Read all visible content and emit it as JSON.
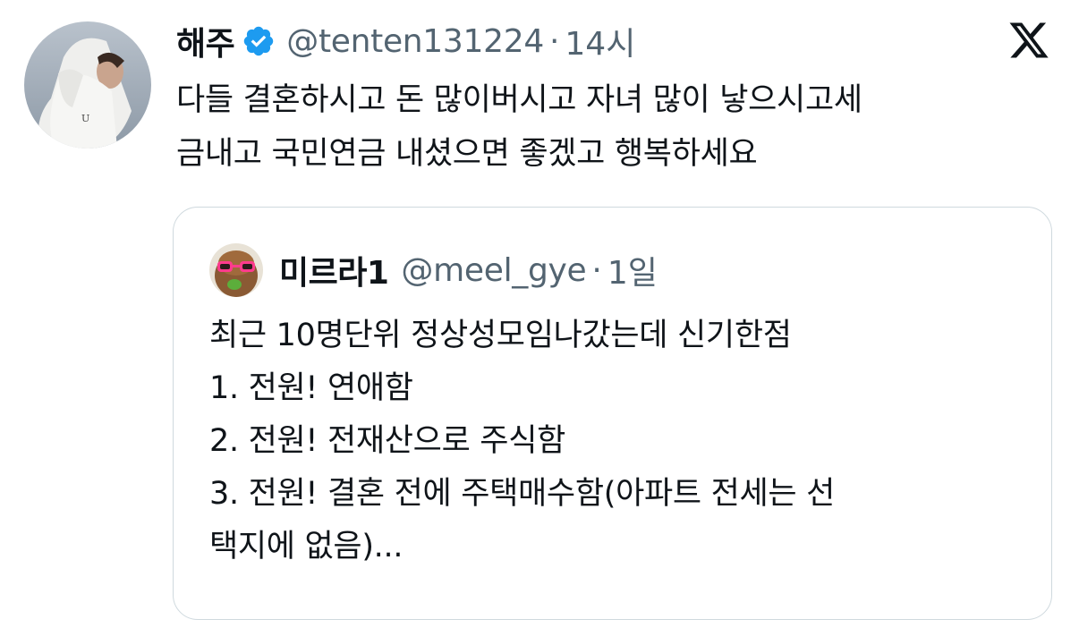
{
  "tweet": {
    "author_name": "해주",
    "handle": "@tenten131224",
    "separator": "·",
    "time": "14시",
    "lines": [
      "다들 결혼하시고 돈 많이버시고 자녀 많이 낳으시고세",
      "금내고 국민연금 내셨으면 좋겠고 행복하세요"
    ]
  },
  "quoted": {
    "author_name": "미르라1",
    "handle": "@meel_gye",
    "separator": "·",
    "time": "1일",
    "lines": [
      "최근 10명단위 정상성모임나갔는데 신기한점",
      "1. 전원! 연애함",
      "2. 전원! 전재산으로 주식함",
      "3. 전원! 결혼 전에 주택매수함(아파트 전세는 선",
      "택지에 없음)..."
    ]
  },
  "icons": {
    "verified": "verified-badge-icon",
    "platform": "x-logo-icon"
  },
  "colors": {
    "text": "#0f1419",
    "secondary": "#536471",
    "verified": "#1d9bf0",
    "border": "#cfd9de"
  }
}
